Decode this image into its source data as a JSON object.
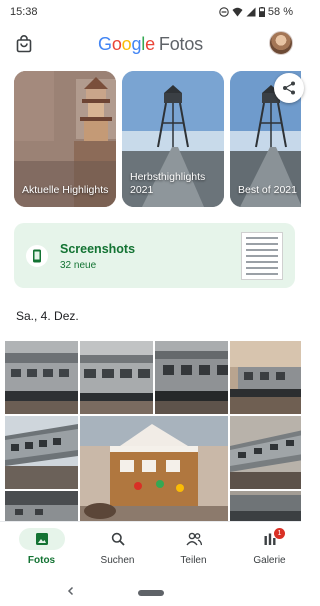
{
  "status_bar": {
    "time": "15:38",
    "battery": "58 %",
    "icons": [
      "do-not-disturb-icon",
      "wifi-icon",
      "signal-icon",
      "battery-icon"
    ]
  },
  "app_bar": {
    "logo_google": "Google",
    "logo_product": "Fotos",
    "left_icon": "shopping-bag-icon",
    "right_icon": "avatar"
  },
  "memories": [
    {
      "label": "Aktuelle Highlights"
    },
    {
      "label": "Herbsthighlights 2021"
    },
    {
      "label": "Best of 2021"
    }
  ],
  "memories_share_icon": "share-icon",
  "screenshots_card": {
    "title": "Screenshots",
    "subtitle": "32 neue",
    "icon": "phone-screenshot-icon"
  },
  "date_header": "Sa., 4. Dez.",
  "photo_grid": {
    "subjects": [
      "model-train",
      "model-train",
      "model-train",
      "model-train",
      "model-train",
      "gingerbread-house",
      "model-train",
      "model-train",
      "model-train",
      "model-train"
    ]
  },
  "bottom_nav": {
    "items": [
      {
        "label": "Fotos",
        "icon": "photo-icon",
        "active": true
      },
      {
        "label": "Suchen",
        "icon": "search-icon",
        "active": false
      },
      {
        "label": "Teilen",
        "icon": "people-icon",
        "active": false
      },
      {
        "label": "Galerie",
        "icon": "library-icon",
        "active": false,
        "badge": "1"
      }
    ]
  },
  "system_nav": {
    "icons": [
      "back-chevron-icon",
      "home-pill"
    ]
  },
  "colors": {
    "accent_green": "#137333",
    "card_green_bg": "#e6f4ea",
    "badge_red": "#d93025",
    "google_blue": "#4285F4",
    "google_red": "#EA4335",
    "google_yellow": "#FBBC05",
    "google_green": "#34A853"
  }
}
